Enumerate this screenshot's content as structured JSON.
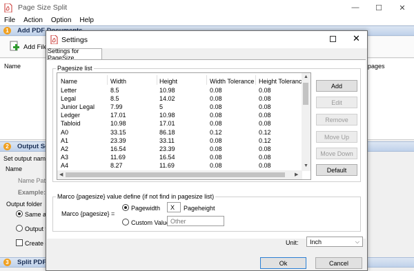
{
  "app": {
    "title": "Page Size Split",
    "menu": [
      "File",
      "Action",
      "Option",
      "Help"
    ],
    "window_controls": {
      "minimize": "—",
      "maximize": "☐",
      "close": "✕"
    }
  },
  "main": {
    "section1": {
      "num": "1",
      "label": "Add PDF Documents"
    },
    "add_files_label": "Add Files",
    "columns": {
      "name": "Name",
      "pages": "f pages"
    },
    "section2": {
      "num": "2",
      "label": "Output Se"
    },
    "set_output_name": "Set output name",
    "name_label": "Name",
    "name_pattern": "Name Patte",
    "example": "Example:",
    "output_folder": "Output folder",
    "same_as": "Same as",
    "output_fi": "Output fi",
    "create_di": "Create di",
    "section3": {
      "num": "3",
      "label": "Split PDF D"
    }
  },
  "dialog": {
    "title": "Settings",
    "tab": "Settings for PageSize",
    "pagesize_list_title": "Pagesize list",
    "columns": [
      "Name",
      "Width",
      "Height",
      "Width Tolerance",
      "Height Tolerance"
    ],
    "rows": [
      {
        "name": "Letter",
        "width": "8.5",
        "height": "10.98",
        "wtol": "0.08",
        "htol": "0.08"
      },
      {
        "name": "Legal",
        "width": "8.5",
        "height": "14.02",
        "wtol": "0.08",
        "htol": "0.08"
      },
      {
        "name": "Junior Legal",
        "width": "7.99",
        "height": "5",
        "wtol": "0.08",
        "htol": "0.08"
      },
      {
        "name": "Ledger",
        "width": "17.01",
        "height": "10.98",
        "wtol": "0.08",
        "htol": "0.08"
      },
      {
        "name": "Tabloid",
        "width": "10.98",
        "height": "17.01",
        "wtol": "0.08",
        "htol": "0.08"
      },
      {
        "name": "A0",
        "width": "33.15",
        "height": "86.18",
        "wtol": "0.12",
        "htol": "0.12"
      },
      {
        "name": "A1",
        "width": "23.39",
        "height": "33.11",
        "wtol": "0.08",
        "htol": "0.12"
      },
      {
        "name": "A2",
        "width": "16.54",
        "height": "23.39",
        "wtol": "0.08",
        "htol": "0.08"
      },
      {
        "name": "A3",
        "width": "11.69",
        "height": "16.54",
        "wtol": "0.08",
        "htol": "0.08"
      },
      {
        "name": "A4",
        "width": "8.27",
        "height": "11.69",
        "wtol": "0.08",
        "htol": "0.08"
      }
    ],
    "buttons": {
      "add": "Add",
      "edit": "Edit",
      "remove": "Remove",
      "move_up": "Move Up",
      "move_down": "Move Down",
      "default": "Default"
    },
    "marco_title": "Marco {pagesize} value define (if not find in pagesize list)",
    "marco_label": "Marco {pagesize} =",
    "pagewidth": "Pagewidth",
    "x_value": "X",
    "pageheight": "Pageheight",
    "custom_value": "Custom Value:",
    "custom_placeholder": "Other",
    "unit_label": "Unit:",
    "unit_value": "Inch",
    "ok": "Ok",
    "cancel": "Cancel"
  }
}
